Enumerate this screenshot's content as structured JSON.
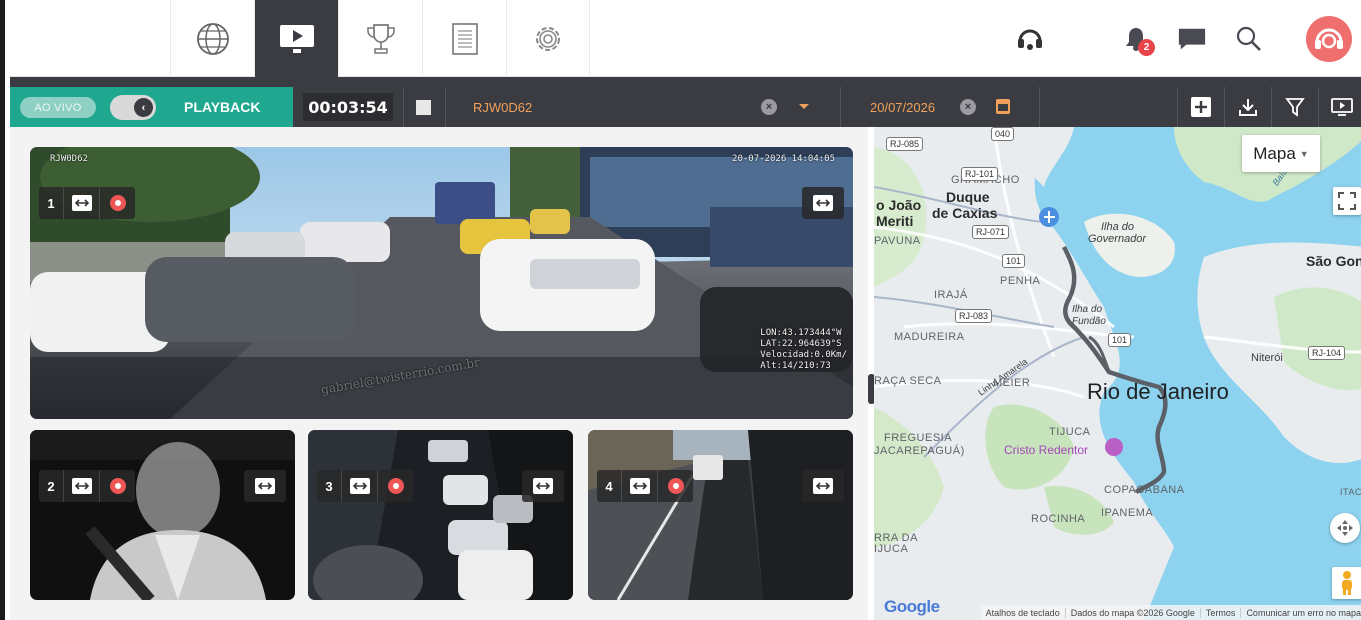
{
  "nav": {
    "tabs": [
      {
        "icon": "globe-icon",
        "active": false
      },
      {
        "icon": "playback-screen-icon",
        "active": true
      },
      {
        "icon": "trophy-icon",
        "active": false
      },
      {
        "icon": "document-icon",
        "active": false
      },
      {
        "icon": "settings-gear-icon",
        "active": false
      }
    ],
    "notifications_count": "2"
  },
  "controls": {
    "live_label": "AO VIVO",
    "playback_label": "PLAYBACK",
    "timer": "00:03:54",
    "vehicle": "RJW0D62",
    "date": "20/07/2026"
  },
  "cameras": [
    {
      "number": "1",
      "top_left": "RJW0D62",
      "timestamp": "20-07-2026 14:04:05",
      "telemetry": [
        "LON:43.173444°W",
        "LAT:22.964639°S",
        "Velocidad:0.0Km/",
        "Alt:14/210:73"
      ],
      "watermark": "gabriel@twisterrio.com.br"
    },
    {
      "number": "2"
    },
    {
      "number": "3"
    },
    {
      "number": "4"
    }
  ],
  "map": {
    "type_selector": "Mapa",
    "labels": {
      "gramacho": "GRAMACHO",
      "sao_joao": "o João",
      "meriti": "Meriti",
      "duque": "Duque",
      "de_caxias": "de Caxias",
      "ilha_do": "Ilha do",
      "governador": "Governador",
      "pavuna": "PAVUNA",
      "sao_gon": "São Gon",
      "iraja": "IRAJÁ",
      "penha": "PENHA",
      "ilha_fundao": "Ilha do",
      "fundao": "Fundão",
      "madureira": "MADUREIRA",
      "niteroi": "Niterói",
      "linha_amarela": "Linha Amarela",
      "praca_seca": "RAÇA SECA",
      "meier": "MÉIER",
      "rio": "Rio de Janeiro",
      "tijuca": "TIJUCA",
      "freguesia": "FREGUESIA",
      "jacarepagua": "JACAREPAGUÁ)",
      "cristo": "Cristo Redentor",
      "copacabana": "COPACABANA",
      "rocinha": "ROCINHA",
      "ipanema": "IPANEMA",
      "barra": "RRA DA",
      "ijuca": "IJUCA",
      "itaco": "ITACO",
      "baia": "Baía de"
    },
    "road_shields": [
      "RJ-085",
      "040",
      "RJ-101",
      "RJ-071",
      "101",
      "RJ-083",
      "101",
      "RJ-104"
    ],
    "footer": [
      "Atalhos de teclado",
      "Dados do mapa ©2026 Google",
      "Termos",
      "Comunicar um erro no mapa"
    ],
    "google_logo": "Google"
  }
}
